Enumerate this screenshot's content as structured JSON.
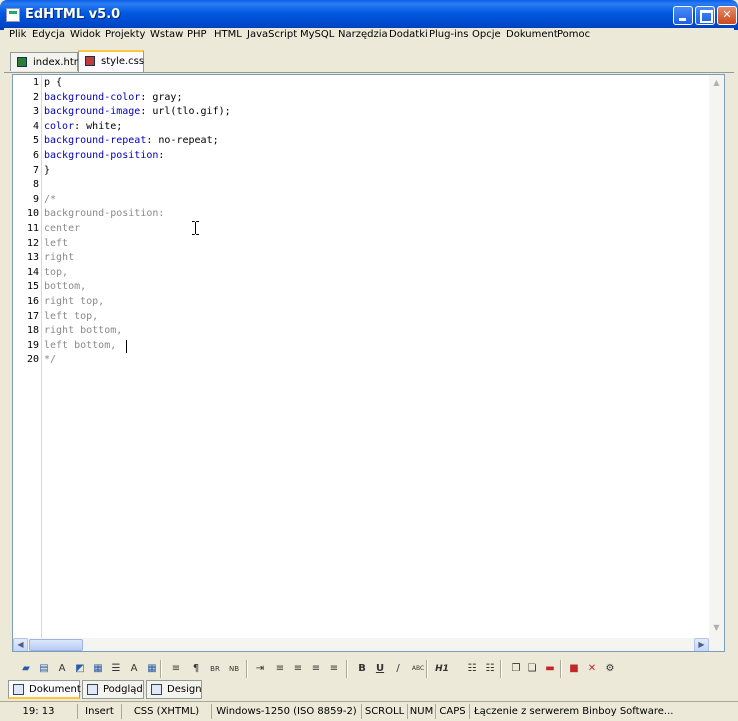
{
  "window": {
    "title": "EdHTML v5.0"
  },
  "menu": [
    "Plik",
    "Edycja",
    "Widok",
    "Projekty",
    "Wstaw",
    "PHP",
    "HTML",
    "JavaScript",
    "MySQL",
    "Narzędzia",
    "Dodatki",
    "Plug-ins",
    "Opcje",
    "Dokument",
    "Pomoc"
  ],
  "tabs": [
    {
      "label": "index.htm",
      "active": false,
      "icon": "file-save-icon"
    },
    {
      "label": "style.css",
      "active": true,
      "icon": "file-save-icon"
    }
  ],
  "editor": {
    "line_numbers": [
      "1",
      "2",
      "3",
      "4",
      "5",
      "6",
      "7",
      "8",
      "9",
      "10",
      "11",
      "12",
      "13",
      "14",
      "15",
      "16",
      "17",
      "18",
      "19",
      "20"
    ],
    "lines": [
      [
        {
          "t": "p {",
          "s": "n"
        }
      ],
      [
        {
          "t": "background-color",
          "s": "k"
        },
        {
          "t": ": gray;",
          "s": "n"
        }
      ],
      [
        {
          "t": "background-image",
          "s": "k"
        },
        {
          "t": ": url(tlo.gif);",
          "s": "n"
        }
      ],
      [
        {
          "t": "color",
          "s": "k"
        },
        {
          "t": ": white;",
          "s": "n"
        }
      ],
      [
        {
          "t": "background-repeat",
          "s": "k"
        },
        {
          "t": ": no-repeat;",
          "s": "n"
        }
      ],
      [
        {
          "t": "background-position",
          "s": "k"
        },
        {
          "t": ":",
          "s": "n"
        }
      ],
      [
        {
          "t": "}",
          "s": "n"
        }
      ],
      [],
      [
        {
          "t": "/*",
          "s": "c"
        }
      ],
      [
        {
          "t": "background-position:",
          "s": "c"
        }
      ],
      [
        {
          "t": "center",
          "s": "c"
        }
      ],
      [
        {
          "t": "left",
          "s": "c"
        }
      ],
      [
        {
          "t": "right",
          "s": "c"
        }
      ],
      [
        {
          "t": "top,",
          "s": "c"
        }
      ],
      [
        {
          "t": "bottom,",
          "s": "c"
        }
      ],
      [
        {
          "t": "right top,",
          "s": "c"
        }
      ],
      [
        {
          "t": "left top,",
          "s": "c"
        }
      ],
      [
        {
          "t": "right bottom,",
          "s": "c"
        }
      ],
      [
        {
          "t": "left bottom,",
          "s": "c"
        }
      ],
      [
        {
          "t": "*/",
          "s": "c"
        }
      ]
    ],
    "colors": {
      "keyword": "#0000C0",
      "normal": "#000000",
      "comment": "#8A8A8A"
    }
  },
  "toolbar": {
    "icons": [
      "folder-icon",
      "save-icon",
      "font-icon",
      "image-icon",
      "table-icon",
      "form-icon",
      "abbr-icon",
      "grid-icon",
      "hr-icon",
      "paragraph-icon",
      "br-icon",
      "nbsp-icon",
      "indent-icon",
      "align-left-icon",
      "align-center-icon",
      "align-right-icon",
      "justify-icon",
      "bold-icon",
      "underline-icon",
      "italic-icon",
      "abc-icon",
      "heading-icon",
      "unordered-list-icon",
      "ordered-list-icon",
      "copy-icon",
      "paste-icon",
      "delete-icon",
      "stop-icon",
      "close-icon",
      "settings-icon"
    ],
    "text_labels": {
      "bold": "B",
      "underline": "U",
      "br": "BR",
      "nbsp": "NB",
      "abc": "ABC",
      "heading": "H1"
    }
  },
  "view_tabs": [
    {
      "label": "Dokument",
      "active": true
    },
    {
      "label": "Podgląd",
      "active": false
    },
    {
      "label": "Design",
      "active": false
    }
  ],
  "status": {
    "position": "19: 13",
    "mode": "Insert",
    "syntax": "CSS (XHTML)",
    "encoding": "Windows-1250 (ISO 8859-2)",
    "scroll": "SCROLL",
    "num": "NUM",
    "caps": "CAPS",
    "message": "Łączenie z serwerem Binboy Software..."
  }
}
